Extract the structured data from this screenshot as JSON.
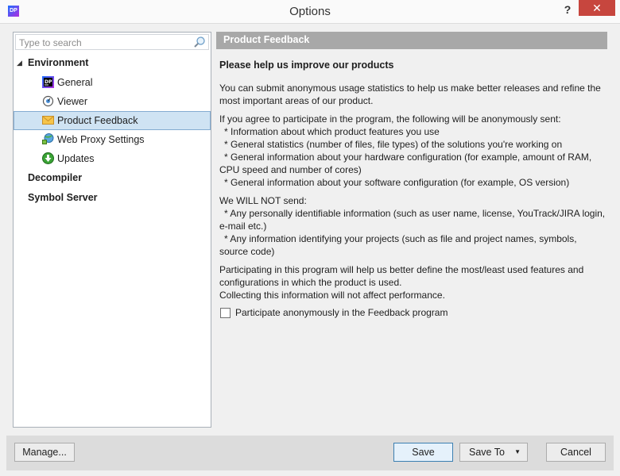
{
  "window": {
    "title": "Options",
    "app_icon_text": "DP",
    "help_label": "?",
    "close_label": "✕"
  },
  "search": {
    "placeholder": "Type to search"
  },
  "tree": {
    "expander": "◢",
    "groups": [
      {
        "label": "Environment"
      },
      {
        "label": "Decompiler"
      },
      {
        "label": "Symbol Server"
      }
    ],
    "items": [
      {
        "label": "General",
        "icon": "dotpeek-icon"
      },
      {
        "label": "Viewer",
        "icon": "eye-icon"
      },
      {
        "label": "Product Feedback",
        "icon": "envelope-icon",
        "selected": true
      },
      {
        "label": "Web Proxy Settings",
        "icon": "globe-network-icon"
      },
      {
        "label": "Updates",
        "icon": "update-arrow-icon"
      }
    ]
  },
  "panel": {
    "header": "Product Feedback",
    "title": "Please help us improve our products",
    "intro": [
      "You can submit anonymous usage statistics to help us make better releases and refine the",
      "most important areas of our product."
    ],
    "send_intro": "If you agree to participate in the program, the following will be anonymously sent:",
    "send_items": [
      "* Information about which product features you use",
      "* General statistics (number of files, file types) of the solutions you're working on",
      "* General information about your hardware configuration (for example, amount of RAM,",
      "CPU speed and number of cores)",
      "* General information about your software configuration (for example, OS version)"
    ],
    "not_send_intro": "We WILL NOT send:",
    "not_send_items": [
      "* Any personally identifiable information (such as user name, license, YouTrack/JIRA login,",
      "e-mail etc.)",
      "* Any information identifying your projects (such as file and project names, symbols,",
      "source code)"
    ],
    "closing": [
      "Participating in this program will help us better define the most/least used features and",
      "configurations in which the product is used.",
      "Collecting this information will not affect performance."
    ],
    "checkbox_label": "Participate anonymously in the Feedback program",
    "checkbox_checked": false
  },
  "footer": {
    "manage": "Manage...",
    "save": "Save",
    "save_to": "Save To",
    "cancel": "Cancel"
  },
  "colors": {
    "accent": "#3c7fb1",
    "selection": "#cfe3f3",
    "header_bar": "#a8a8a8",
    "close_button": "#c7463e"
  }
}
